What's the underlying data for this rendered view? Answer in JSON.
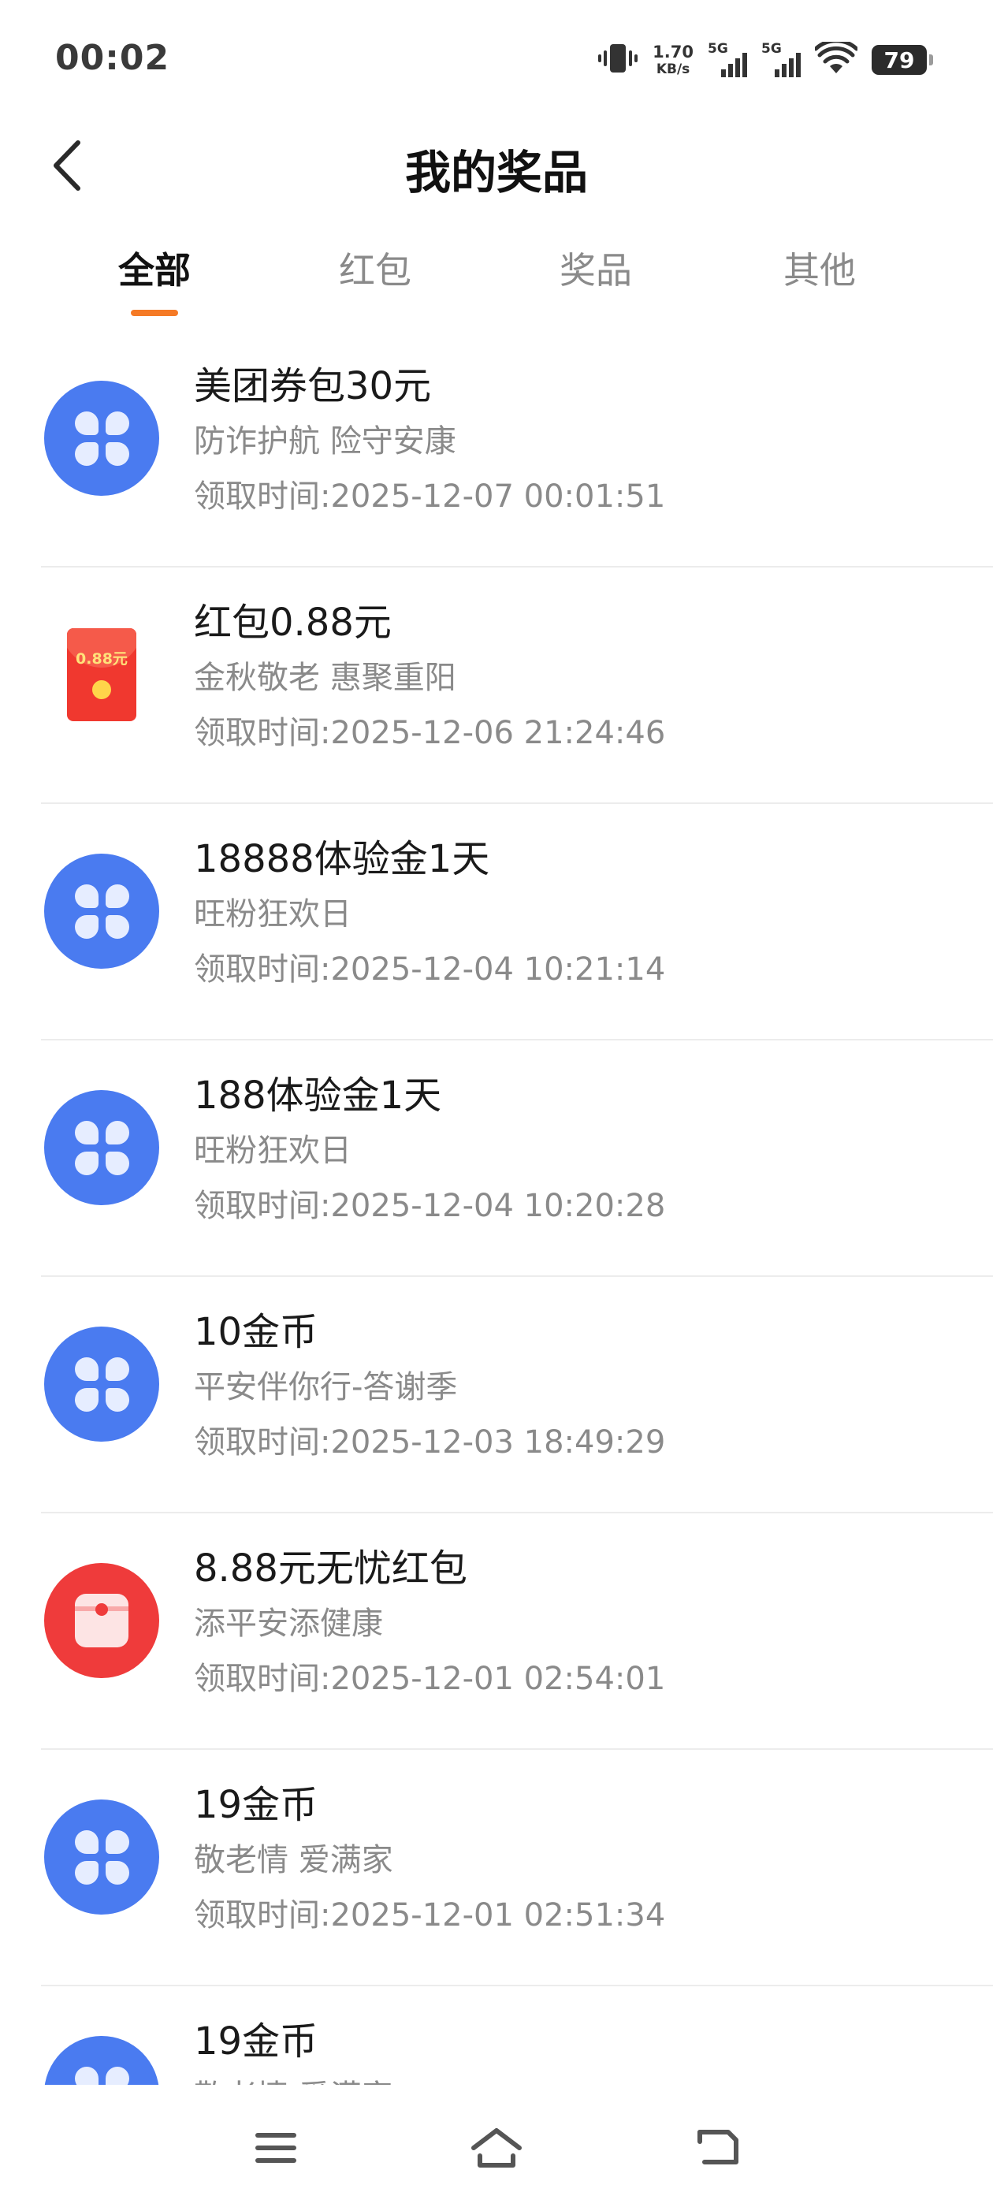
{
  "status_bar": {
    "time": "00:02",
    "net_speed_value": "1.70",
    "net_speed_unit": "KB/s",
    "sim1_label": "5G",
    "sim2_label": "5G",
    "battery": "79"
  },
  "header": {
    "title": "我的奖品"
  },
  "tabs": [
    {
      "label": "全部",
      "active": true
    },
    {
      "label": "红包",
      "active": false
    },
    {
      "label": "奖品",
      "active": false
    },
    {
      "label": "其他",
      "active": false
    }
  ],
  "prizes": [
    {
      "icon": "clover-icon",
      "title": "美团券包30元",
      "subtitle": "防诈护航 险守安康",
      "time": "领取时间:2025-12-07 00:01:51"
    },
    {
      "icon": "red-envelope-icon",
      "envelope_amount": "0.88元",
      "title": "红包0.88元",
      "subtitle": "金秋敬老 惠聚重阳",
      "time": "领取时间:2025-12-06 21:24:46"
    },
    {
      "icon": "clover-icon",
      "title": "18888体验金1天",
      "subtitle": "旺粉狂欢日",
      "time": "领取时间:2025-12-04 10:21:14"
    },
    {
      "icon": "clover-icon",
      "title": "188体验金1天",
      "subtitle": "旺粉狂欢日",
      "time": "领取时间:2025-12-04 10:20:28"
    },
    {
      "icon": "clover-icon",
      "title": "10金币",
      "subtitle": "平安伴你行-答谢季",
      "time": "领取时间:2025-12-03 18:49:29"
    },
    {
      "icon": "gift-icon",
      "title": "8.88元无忧红包",
      "subtitle": "添平安添健康",
      "time": "领取时间:2025-12-01 02:54:01"
    },
    {
      "icon": "clover-icon",
      "title": "19金币",
      "subtitle": "敬老情 爱满家",
      "time": "领取时间:2025-12-01 02:51:34"
    },
    {
      "icon": "clover-icon",
      "title": "19金币",
      "subtitle": "敬老情 爱满家",
      "time": ""
    }
  ],
  "colors": {
    "accent_orange": "#f57a26",
    "icon_blue": "#4a7bf0",
    "icon_red": "#ef3b3b"
  }
}
